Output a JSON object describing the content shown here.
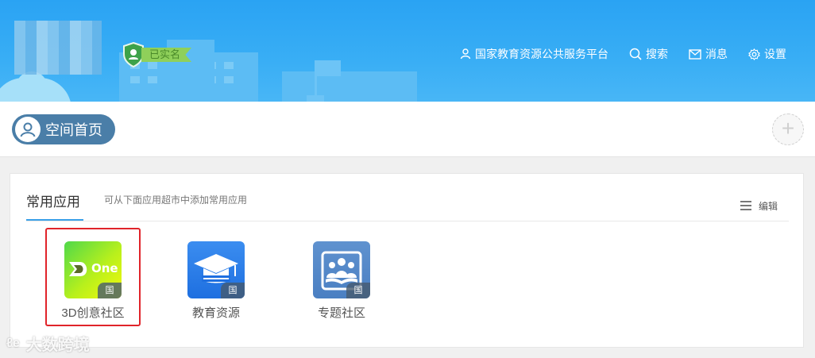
{
  "header": {
    "verified_label": "已实名",
    "nav": [
      {
        "icon": "user-icon",
        "label": "国家教育资源公共服务平台"
      },
      {
        "icon": "search-icon",
        "label": "搜索"
      },
      {
        "icon": "mail-icon",
        "label": "消息"
      },
      {
        "icon": "gear-icon",
        "label": "设置"
      }
    ]
  },
  "space": {
    "home_label": "空间首页",
    "add_symbol": "+"
  },
  "apps_panel": {
    "title": "常用应用",
    "hint": "可从下面应用超市中添加常用应用",
    "edit_label": "编辑",
    "apps": [
      {
        "name": "3D创意社区",
        "badge": "国",
        "logo_text": "One",
        "selected": true
      },
      {
        "name": "教育资源",
        "badge": "国",
        "selected": false
      },
      {
        "name": "专题社区",
        "badge": "国",
        "selected": false
      }
    ]
  },
  "watermark": {
    "logo": "ℓe",
    "text": "大数跨境"
  },
  "colors": {
    "banner": "#2aa3f3",
    "accent": "#3aa0e8",
    "selection": "#e0242a",
    "pill": "#4a7ea8"
  }
}
